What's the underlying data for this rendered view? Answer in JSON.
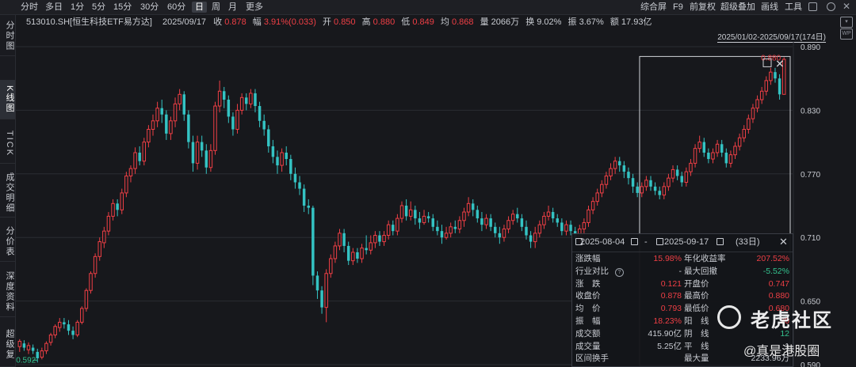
{
  "toolbar": {
    "periods": [
      "分时",
      "多日",
      "1分",
      "5分",
      "15分",
      "30分",
      "60分",
      "日",
      "周",
      "月",
      "更多"
    ],
    "active_period": "日",
    "right_items": [
      "综合屏",
      "F9",
      "前复权",
      "超级叠加",
      "画线",
      "工具"
    ]
  },
  "sidebar": {
    "tabs": [
      "分时图",
      "K线图",
      "TICK",
      "成交明细",
      "分价表",
      "深度资料",
      "超级复"
    ],
    "active": "K线图"
  },
  "info": {
    "code_name": "513010.SH[恒生科技ETF易方达]",
    "date": "2025/09/17",
    "close_label": "收",
    "close": "0.878",
    "change_label": "幅",
    "change": "3.91%(0.033)",
    "open_label": "开",
    "open": "0.850",
    "high_label": "高",
    "high": "0.880",
    "low_label": "低",
    "low": "0.849",
    "avg_label": "均",
    "avg": "0.868",
    "volume_label": "量",
    "volume": "2066万",
    "turnover_label": "换",
    "turnover": "9.02%",
    "amplitude_label": "振",
    "amplitude": "3.67%",
    "amount_label": "额",
    "amount": "17.93亿"
  },
  "range_text": "2025/01/02-2025/09/17(174日)",
  "stat_panel": {
    "start_date": "2025-08-04",
    "separator": "-",
    "end_date": "2025-09-17",
    "days": "(33日)",
    "rows": [
      {
        "k1": "涨跌幅",
        "v1": "15.98%",
        "k2": "年化收益率",
        "v2": "207.52%"
      },
      {
        "k1": "行业对比",
        "v1": "-",
        "k2": "最大回撤",
        "v2": "-5.52%"
      },
      {
        "k1": "涨　跌",
        "v1": "0.121",
        "k2": "开盘价",
        "v2": "0.747"
      },
      {
        "k1": "收盘价",
        "v1": "0.878",
        "k2": "最高价",
        "v2": "0.880"
      },
      {
        "k1": "均　价",
        "v1": "0.793",
        "k2": "最低价",
        "v2": "0.680"
      },
      {
        "k1": "振　幅",
        "v1": "18.23%",
        "k2": "阳　线",
        "v2": "20"
      },
      {
        "k1": "成交额",
        "v1": "415.90亿",
        "k2": "阴　线",
        "v2": "12"
      },
      {
        "k1": "成交量",
        "v1": "5.25亿",
        "k2": "平　线",
        "v2": "1"
      },
      {
        "k1": "区间换手",
        "v1": "",
        "k2": "最大量",
        "v2": "2233.96万"
      }
    ]
  },
  "watermark": {
    "brand": "老虎社区",
    "sub": "@真是港股圈"
  },
  "colors": {
    "up": "#ef3f45",
    "down": "#34c3c3",
    "background": "#17181c",
    "grid": "#2a2c32"
  },
  "chart_data": {
    "type": "candlestick",
    "y_ticks": [
      "0.890",
      "0.830",
      "0.770",
      "0.710",
      "0.650",
      "0.590"
    ],
    "ylim": [
      0.59,
      0.89
    ],
    "low_marker": "0.592",
    "high_marker": "0.880",
    "candles": [
      [
        0.607,
        0.612,
        0.614,
        0.602
      ],
      [
        0.61,
        0.606,
        0.613,
        0.603
      ],
      [
        0.604,
        0.608,
        0.611,
        0.6
      ],
      [
        0.606,
        0.603,
        0.609,
        0.6
      ],
      [
        0.602,
        0.596,
        0.605,
        0.592
      ],
      [
        0.597,
        0.603,
        0.606,
        0.595
      ],
      [
        0.603,
        0.61,
        0.612,
        0.6
      ],
      [
        0.611,
        0.618,
        0.62,
        0.608
      ],
      [
        0.618,
        0.626,
        0.628,
        0.615
      ],
      [
        0.625,
        0.63,
        0.634,
        0.621
      ],
      [
        0.63,
        0.628,
        0.634,
        0.624
      ],
      [
        0.628,
        0.622,
        0.632,
        0.618
      ],
      [
        0.622,
        0.618,
        0.626,
        0.614
      ],
      [
        0.618,
        0.63,
        0.632,
        0.616
      ],
      [
        0.63,
        0.643,
        0.645,
        0.628
      ],
      [
        0.643,
        0.66,
        0.662,
        0.64
      ],
      [
        0.66,
        0.676,
        0.678,
        0.657
      ],
      [
        0.676,
        0.692,
        0.695,
        0.672
      ],
      [
        0.692,
        0.706,
        0.71,
        0.688
      ],
      [
        0.705,
        0.716,
        0.72,
        0.7
      ],
      [
        0.716,
        0.73,
        0.734,
        0.712
      ],
      [
        0.73,
        0.742,
        0.746,
        0.726
      ],
      [
        0.742,
        0.736,
        0.746,
        0.73
      ],
      [
        0.736,
        0.752,
        0.756,
        0.732
      ],
      [
        0.752,
        0.768,
        0.772,
        0.748
      ],
      [
        0.768,
        0.775,
        0.778,
        0.762
      ],
      [
        0.775,
        0.79,
        0.795,
        0.77
      ],
      [
        0.79,
        0.782,
        0.796,
        0.778
      ],
      [
        0.782,
        0.8,
        0.804,
        0.778
      ],
      [
        0.8,
        0.812,
        0.816,
        0.795
      ],
      [
        0.812,
        0.82,
        0.826,
        0.806
      ],
      [
        0.82,
        0.832,
        0.838,
        0.814
      ],
      [
        0.832,
        0.826,
        0.84,
        0.818
      ],
      [
        0.826,
        0.808,
        0.83,
        0.802
      ],
      [
        0.808,
        0.82,
        0.824,
        0.802
      ],
      [
        0.82,
        0.836,
        0.842,
        0.814
      ],
      [
        0.836,
        0.845,
        0.85,
        0.83
      ],
      [
        0.845,
        0.826,
        0.848,
        0.82
      ],
      [
        0.826,
        0.8,
        0.83,
        0.794
      ],
      [
        0.8,
        0.78,
        0.806,
        0.772
      ],
      [
        0.78,
        0.8,
        0.806,
        0.774
      ],
      [
        0.8,
        0.792,
        0.806,
        0.786
      ],
      [
        0.792,
        0.776,
        0.798,
        0.77
      ],
      [
        0.776,
        0.792,
        0.798,
        0.772
      ],
      [
        0.792,
        0.834,
        0.838,
        0.788
      ],
      [
        0.834,
        0.848,
        0.858,
        0.828
      ],
      [
        0.848,
        0.84,
        0.852,
        0.832
      ],
      [
        0.84,
        0.824,
        0.844,
        0.818
      ],
      [
        0.824,
        0.812,
        0.828,
        0.806
      ],
      [
        0.812,
        0.83,
        0.836,
        0.808
      ],
      [
        0.83,
        0.842,
        0.846,
        0.826
      ],
      [
        0.842,
        0.836,
        0.846,
        0.83
      ],
      [
        0.836,
        0.846,
        0.85,
        0.832
      ],
      [
        0.846,
        0.834,
        0.85,
        0.828
      ],
      [
        0.834,
        0.82,
        0.838,
        0.814
      ],
      [
        0.82,
        0.812,
        0.826,
        0.806
      ],
      [
        0.812,
        0.796,
        0.816,
        0.79
      ],
      [
        0.796,
        0.786,
        0.802,
        0.78
      ],
      [
        0.786,
        0.778,
        0.792,
        0.77
      ],
      [
        0.778,
        0.79,
        0.794,
        0.772
      ],
      [
        0.79,
        0.784,
        0.796,
        0.778
      ],
      [
        0.784,
        0.77,
        0.788,
        0.764
      ],
      [
        0.77,
        0.762,
        0.776,
        0.756
      ],
      [
        0.762,
        0.756,
        0.768,
        0.75
      ],
      [
        0.756,
        0.74,
        0.76,
        0.734
      ],
      [
        0.74,
        0.738,
        0.746,
        0.732
      ],
      [
        0.738,
        0.674,
        0.74,
        0.665
      ],
      [
        0.674,
        0.66,
        0.678,
        0.652
      ],
      [
        0.66,
        0.644,
        0.664,
        0.638
      ],
      [
        0.644,
        0.676,
        0.68,
        0.63
      ],
      [
        0.676,
        0.69,
        0.694,
        0.672
      ],
      [
        0.69,
        0.702,
        0.706,
        0.686
      ],
      [
        0.702,
        0.714,
        0.718,
        0.698
      ],
      [
        0.714,
        0.702,
        0.718,
        0.696
      ],
      [
        0.702,
        0.688,
        0.706,
        0.684
      ],
      [
        0.688,
        0.696,
        0.7,
        0.684
      ],
      [
        0.696,
        0.69,
        0.7,
        0.686
      ],
      [
        0.69,
        0.7,
        0.704,
        0.686
      ],
      [
        0.7,
        0.698,
        0.712,
        0.694
      ],
      [
        0.698,
        0.705,
        0.712,
        0.694
      ],
      [
        0.705,
        0.712,
        0.716,
        0.7
      ],
      [
        0.712,
        0.706,
        0.716,
        0.702
      ],
      [
        0.706,
        0.712,
        0.716,
        0.702
      ],
      [
        0.712,
        0.722,
        0.726,
        0.708
      ],
      [
        0.722,
        0.716,
        0.726,
        0.712
      ],
      [
        0.716,
        0.728,
        0.732,
        0.712
      ],
      [
        0.728,
        0.74,
        0.744,
        0.724
      ],
      [
        0.74,
        0.73,
        0.746,
        0.726
      ],
      [
        0.73,
        0.736,
        0.744,
        0.726
      ],
      [
        0.736,
        0.728,
        0.74,
        0.722
      ],
      [
        0.728,
        0.724,
        0.734,
        0.718
      ],
      [
        0.724,
        0.73,
        0.736,
        0.722
      ],
      [
        0.73,
        0.728,
        0.734,
        0.724
      ],
      [
        0.728,
        0.72,
        0.732,
        0.716
      ],
      [
        0.72,
        0.716,
        0.726,
        0.712
      ],
      [
        0.716,
        0.71,
        0.722,
        0.704
      ],
      [
        0.71,
        0.714,
        0.72,
        0.708
      ],
      [
        0.714,
        0.72,
        0.724,
        0.71
      ],
      [
        0.72,
        0.718,
        0.726,
        0.714
      ],
      [
        0.718,
        0.726,
        0.73,
        0.714
      ],
      [
        0.726,
        0.734,
        0.738,
        0.72
      ],
      [
        0.734,
        0.742,
        0.748,
        0.73
      ],
      [
        0.742,
        0.736,
        0.746,
        0.73
      ],
      [
        0.736,
        0.728,
        0.74,
        0.724
      ],
      [
        0.728,
        0.722,
        0.734,
        0.716
      ],
      [
        0.722,
        0.728,
        0.732,
        0.718
      ],
      [
        0.728,
        0.72,
        0.732,
        0.716
      ],
      [
        0.72,
        0.714,
        0.724,
        0.71
      ],
      [
        0.714,
        0.71,
        0.72,
        0.704
      ],
      [
        0.71,
        0.718,
        0.722,
        0.706
      ],
      [
        0.718,
        0.726,
        0.73,
        0.714
      ],
      [
        0.726,
        0.732,
        0.736,
        0.722
      ],
      [
        0.732,
        0.728,
        0.738,
        0.724
      ],
      [
        0.728,
        0.72,
        0.732,
        0.716
      ],
      [
        0.72,
        0.712,
        0.726,
        0.708
      ],
      [
        0.712,
        0.706,
        0.716,
        0.7
      ],
      [
        0.706,
        0.714,
        0.72,
        0.7
      ],
      [
        0.714,
        0.722,
        0.726,
        0.71
      ],
      [
        0.722,
        0.73,
        0.734,
        0.718
      ],
      [
        0.73,
        0.734,
        0.74,
        0.726
      ],
      [
        0.734,
        0.728,
        0.738,
        0.724
      ],
      [
        0.728,
        0.724,
        0.732,
        0.72
      ],
      [
        0.724,
        0.716,
        0.728,
        0.712
      ],
      [
        0.716,
        0.722,
        0.726,
        0.712
      ],
      [
        0.722,
        0.716,
        0.726,
        0.712
      ],
      [
        0.716,
        0.708,
        0.72,
        0.704
      ],
      [
        0.708,
        0.718,
        0.722,
        0.704
      ],
      [
        0.718,
        0.724,
        0.728,
        0.714
      ],
      [
        0.724,
        0.736,
        0.74,
        0.72
      ],
      [
        0.736,
        0.744,
        0.748,
        0.732
      ],
      [
        0.744,
        0.752,
        0.756,
        0.74
      ],
      [
        0.752,
        0.76,
        0.764,
        0.748
      ],
      [
        0.76,
        0.768,
        0.772,
        0.756
      ],
      [
        0.768,
        0.775,
        0.78,
        0.764
      ],
      [
        0.775,
        0.782,
        0.786,
        0.77
      ],
      [
        0.782,
        0.778,
        0.786,
        0.772
      ],
      [
        0.778,
        0.772,
        0.782,
        0.766
      ],
      [
        0.772,
        0.766,
        0.776,
        0.76
      ],
      [
        0.766,
        0.758,
        0.77,
        0.752
      ],
      [
        0.758,
        0.752,
        0.762,
        0.748
      ],
      [
        0.752,
        0.758,
        0.762,
        0.748
      ],
      [
        0.758,
        0.764,
        0.768,
        0.754
      ],
      [
        0.764,
        0.758,
        0.768,
        0.754
      ],
      [
        0.758,
        0.754,
        0.762,
        0.75
      ],
      [
        0.754,
        0.75,
        0.758,
        0.746
      ],
      [
        0.75,
        0.758,
        0.762,
        0.746
      ],
      [
        0.758,
        0.766,
        0.77,
        0.754
      ],
      [
        0.766,
        0.774,
        0.778,
        0.762
      ],
      [
        0.774,
        0.768,
        0.778,
        0.764
      ],
      [
        0.768,
        0.762,
        0.772,
        0.758
      ],
      [
        0.762,
        0.772,
        0.776,
        0.758
      ],
      [
        0.772,
        0.78,
        0.784,
        0.768
      ],
      [
        0.78,
        0.794,
        0.798,
        0.776
      ],
      [
        0.794,
        0.8,
        0.806,
        0.79
      ],
      [
        0.8,
        0.79,
        0.804,
        0.786
      ],
      [
        0.79,
        0.784,
        0.794,
        0.78
      ],
      [
        0.784,
        0.79,
        0.794,
        0.78
      ],
      [
        0.79,
        0.798,
        0.802,
        0.786
      ],
      [
        0.798,
        0.79,
        0.802,
        0.786
      ],
      [
        0.79,
        0.78,
        0.794,
        0.776
      ],
      [
        0.78,
        0.788,
        0.792,
        0.776
      ],
      [
        0.788,
        0.796,
        0.8,
        0.784
      ],
      [
        0.796,
        0.804,
        0.808,
        0.792
      ],
      [
        0.804,
        0.812,
        0.816,
        0.8
      ],
      [
        0.812,
        0.822,
        0.826,
        0.808
      ],
      [
        0.822,
        0.832,
        0.836,
        0.818
      ],
      [
        0.832,
        0.84,
        0.844,
        0.828
      ],
      [
        0.84,
        0.848,
        0.852,
        0.836
      ],
      [
        0.848,
        0.858,
        0.862,
        0.844
      ],
      [
        0.858,
        0.866,
        0.87,
        0.854
      ],
      [
        0.866,
        0.86,
        0.87,
        0.856
      ],
      [
        0.86,
        0.845,
        0.864,
        0.84
      ],
      [
        0.845,
        0.878,
        0.88,
        0.849
      ]
    ]
  }
}
